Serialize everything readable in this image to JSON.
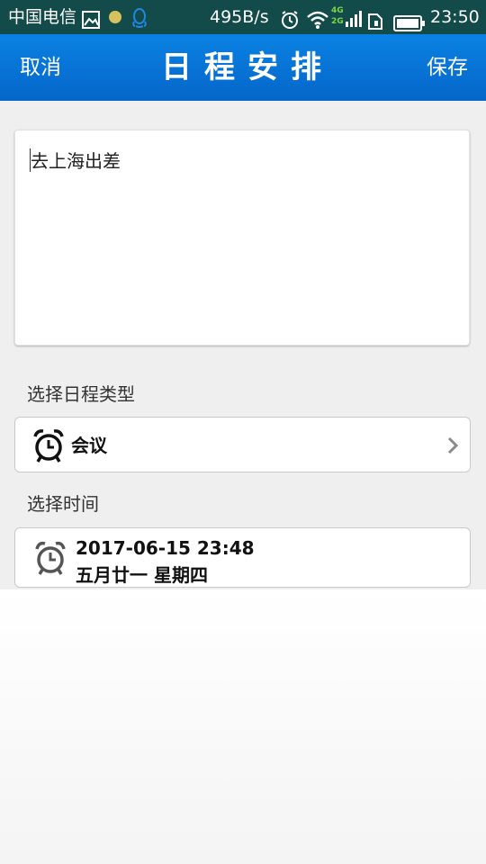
{
  "status_bar": {
    "carrier": "中国电信",
    "network_speed": "495B/s",
    "signal_labels": [
      "4G",
      "2G"
    ],
    "time": "23:50",
    "icons": [
      "gallery-icon",
      "notification-dot-icon",
      "qq-icon",
      "alarm-icon",
      "wifi-icon",
      "signal-icon",
      "sim-icon",
      "battery-icon"
    ],
    "background": "#124b49"
  },
  "title_bar": {
    "cancel_label": "取消",
    "title": "日程安排",
    "save_label": "保存",
    "background": "#0a82e3"
  },
  "note": {
    "text": "去上海出差"
  },
  "schedule_type": {
    "label": "选择日程类型",
    "value": "会议",
    "icon": "alarm-clock-icon"
  },
  "schedule_time": {
    "label": "选择时间",
    "datetime": "2017-06-15 23:48",
    "lunar": "五月廿一 星期四",
    "icon": "alarm-clock-icon"
  }
}
